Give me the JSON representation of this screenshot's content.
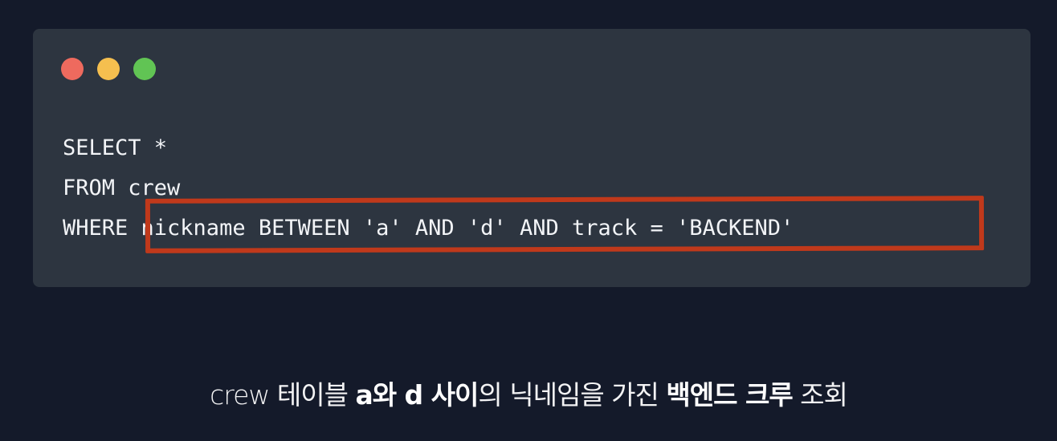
{
  "colors": {
    "background": "#141a2a",
    "window": "#2d3540",
    "code_text": "#f2f4f7",
    "highlight": "#c0391b",
    "caption_text": "#ffffff"
  },
  "window": {
    "controls": [
      {
        "name": "close",
        "color": "#ee6a5e"
      },
      {
        "name": "minimize",
        "color": "#f5bf4f"
      },
      {
        "name": "maximize",
        "color": "#61c454"
      }
    ]
  },
  "code": {
    "lines": [
      "SELECT *",
      "FROM crew",
      "WHERE nickname BETWEEN 'a' AND 'd' AND track = 'BACKEND'"
    ],
    "highlighted_text": "nickname BETWEEN 'a' AND 'd' AND track = 'BACKEND'"
  },
  "caption": {
    "segments": [
      {
        "text": "crew 테이블 ",
        "bold": false
      },
      {
        "text": "a와 d 사이",
        "bold": true
      },
      {
        "text": "의 닉네임을 가진 ",
        "bold": false
      },
      {
        "text": "백엔드 크루",
        "bold": true
      },
      {
        "text": " 조회",
        "bold": false
      }
    ]
  }
}
